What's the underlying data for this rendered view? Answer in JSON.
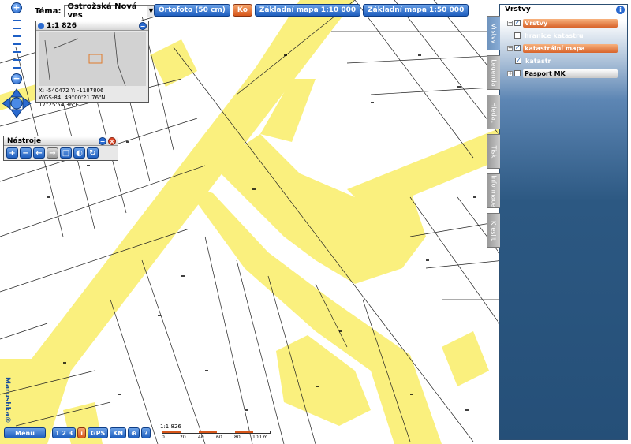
{
  "map": {
    "colors": {
      "background": "#ffffff",
      "road_fill": "#faf07e",
      "parcel_line": "#222222"
    }
  },
  "theme": {
    "label": "Téma:",
    "selected": "Ostrožská Nová ves"
  },
  "top_buttons": {
    "ortofoto": "Ortofoto (50 cm)",
    "orange": "Ko",
    "base_10000": "Základní mapa 1:10 000",
    "base_50000": "Základní mapa 1:50 000"
  },
  "overview": {
    "scale": "1:1 826",
    "xy": "X: -540472 Y: -1187806",
    "wgs": "WGS-84: 49°00'21.76\"N, 17°25'54.36\"E"
  },
  "tools": {
    "title": "Nástroje"
  },
  "panel": {
    "title": "Vrstvy",
    "tabs": [
      "Vrstvy",
      "Legenda",
      "Hledat",
      "Tisk",
      "Informace",
      "Kreslit"
    ],
    "tree": [
      {
        "label": "Vrstvy",
        "style": "orange",
        "expand": "−",
        "checked": true
      },
      {
        "label": "hranice katastru",
        "style": "plain",
        "expand": "",
        "checked": false
      },
      {
        "label": "katastrální mapa",
        "style": "orange",
        "expand": "−",
        "checked": true
      },
      {
        "label": "katastr",
        "style": "plain",
        "expand": "",
        "checked": true
      },
      {
        "label": "Pasport MK",
        "style": "gray",
        "expand": "+",
        "checked": false
      }
    ]
  },
  "bottom": {
    "menu": "Menu",
    "coord": "1 2 3",
    "info": "i",
    "gps": "GPS",
    "kn": "KN",
    "target": "⊕",
    "help": "?"
  },
  "scale": {
    "ratio": "1:1 826",
    "ticks": [
      "0",
      "20",
      "40",
      "60",
      "80",
      "100 m"
    ]
  },
  "brand": "Marushka®"
}
